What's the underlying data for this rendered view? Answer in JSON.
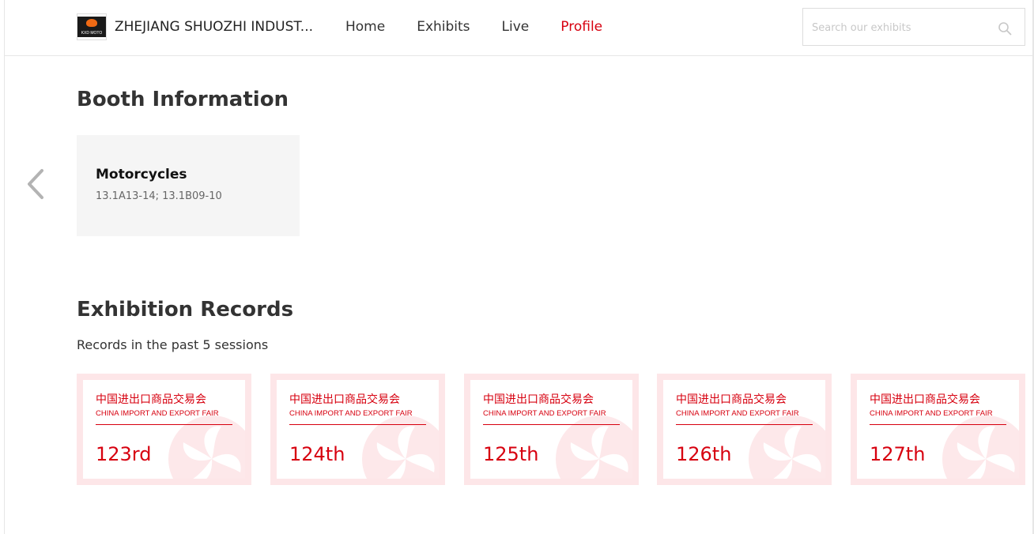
{
  "header": {
    "logo_text": "KXD MOTO",
    "company_name": "ZHEJIANG SHUOZHI INDUST...",
    "nav": [
      {
        "label": "Home",
        "active": false
      },
      {
        "label": "Exhibits",
        "active": false
      },
      {
        "label": "Live",
        "active": false
      },
      {
        "label": "Profile",
        "active": true
      }
    ],
    "search": {
      "placeholder": "Search our exhibits",
      "value": "",
      "icon": "search-icon"
    }
  },
  "booth": {
    "title": "Booth Information",
    "prev_icon": "chevron-left-icon",
    "cards": [
      {
        "name": "Motorcycles",
        "code": "13.1A13-14; 13.1B09-10"
      }
    ]
  },
  "records": {
    "title": "Exhibition Records",
    "subtitle": "Records in the past 5 sessions",
    "items": [
      {
        "cn": "中国进出口商品交易会",
        "en": "CHINA IMPORT AND EXPORT FAIR",
        "session": "123rd"
      },
      {
        "cn": "中国进出口商品交易会",
        "en": "CHINA IMPORT AND EXPORT FAIR",
        "session": "124th"
      },
      {
        "cn": "中国进出口商品交易会",
        "en": "CHINA IMPORT AND EXPORT FAIR",
        "session": "125th"
      },
      {
        "cn": "中国进出口商品交易会",
        "en": "CHINA IMPORT AND EXPORT FAIR",
        "session": "126th"
      },
      {
        "cn": "中国进出口商品交易会",
        "en": "CHINA IMPORT AND EXPORT FAIR",
        "session": "127th"
      }
    ]
  },
  "colors": {
    "accent": "#d7000f",
    "card_bg": "#f5f5f5",
    "record_border": "#fde6e8"
  }
}
